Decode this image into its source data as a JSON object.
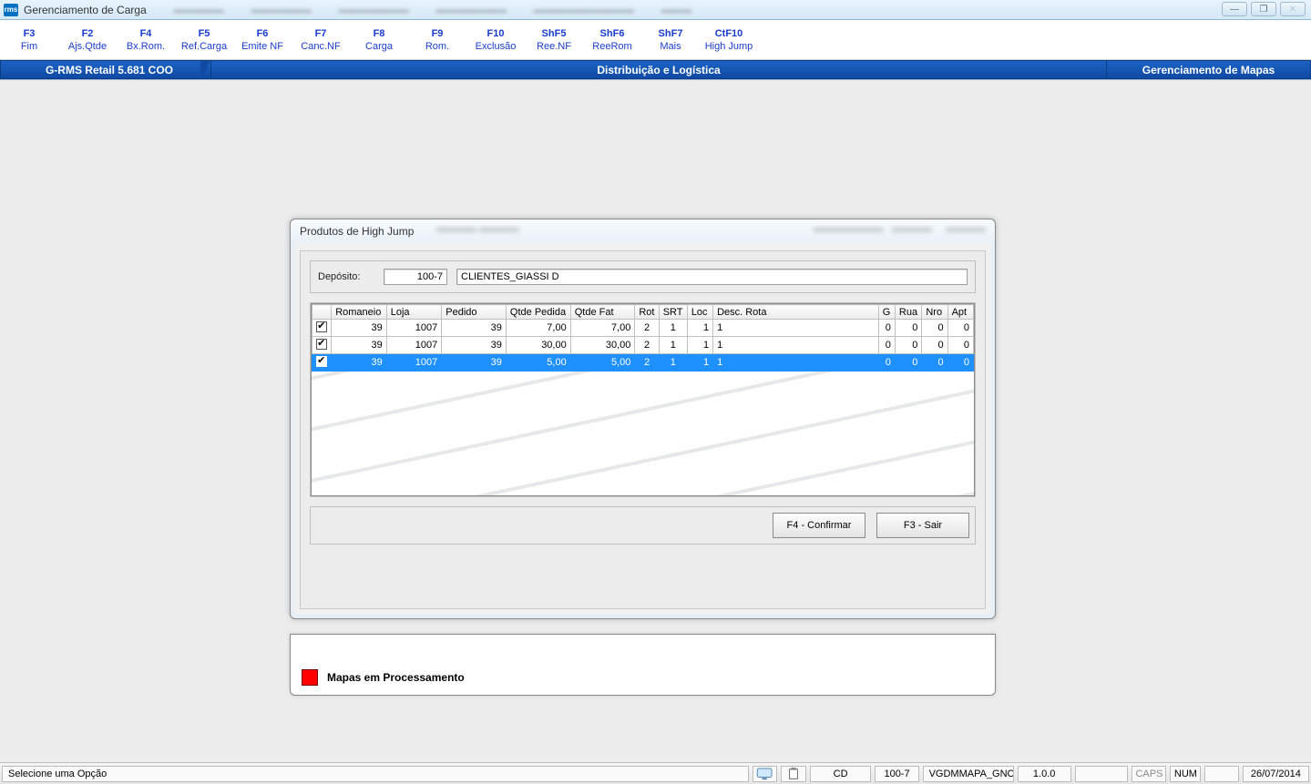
{
  "window": {
    "title": "Gerenciamento de Carga"
  },
  "fkeys": [
    {
      "key": "F3",
      "label": "Fim"
    },
    {
      "key": "F2",
      "label": "Ajs.Qtde"
    },
    {
      "key": "F4",
      "label": "Bx.Rom."
    },
    {
      "key": "F5",
      "label": "Ref.Carga"
    },
    {
      "key": "F6",
      "label": "Emite NF"
    },
    {
      "key": "F7",
      "label": "Canc.NF"
    },
    {
      "key": "F8",
      "label": "Carga"
    },
    {
      "key": "F9",
      "label": "Rom."
    },
    {
      "key": "F10",
      "label": "Exclusão"
    },
    {
      "key": "ShF5",
      "label": "Ree.NF"
    },
    {
      "key": "ShF6",
      "label": "ReeRom"
    },
    {
      "key": "ShF7",
      "label": "Mais"
    },
    {
      "key": "CtF10",
      "label": "High Jump"
    }
  ],
  "ribbon": {
    "left": "G-RMS Retail 5.681 COO",
    "center": "Distribuição e Logística",
    "right": "Gerenciamento de Mapas"
  },
  "dialog": {
    "title": "Produtos de High Jump",
    "deposito_label": "Depósito:",
    "deposito_code": "100-7",
    "deposito_name": "CLIENTES_GIASSI D",
    "columns": [
      "",
      "Romaneio",
      "Loja",
      "Pedido",
      "Qtde Pedida",
      "Qtde Fat",
      "Rot",
      "SRT",
      "Loc",
      "Desc. Rota",
      "G",
      "Rua",
      "Nro",
      "Apt"
    ],
    "rows": [
      {
        "sel": false,
        "chk": true,
        "romaneio": "39",
        "loja": "1007",
        "pedido": "39",
        "qp": "7,00",
        "qf": "7,00",
        "rot": "2",
        "srt": "1",
        "loc": "1",
        "desc": "1",
        "g": "0",
        "rua": "0",
        "nro": "0",
        "apt": "0"
      },
      {
        "sel": false,
        "chk": true,
        "romaneio": "39",
        "loja": "1007",
        "pedido": "39",
        "qp": "30,00",
        "qf": "30,00",
        "rot": "2",
        "srt": "1",
        "loc": "1",
        "desc": "1",
        "g": "0",
        "rua": "0",
        "nro": "0",
        "apt": "0"
      },
      {
        "sel": true,
        "chk": true,
        "romaneio": "39",
        "loja": "1007",
        "pedido": "39",
        "qp": "5,00",
        "qf": "5,00",
        "rot": "2",
        "srt": "1",
        "loc": "1",
        "desc": "1",
        "g": "0",
        "rua": "0",
        "nro": "0",
        "apt": "0"
      }
    ],
    "btn_confirm": "F4 - Confirmar",
    "btn_exit": "F3 - Sair"
  },
  "processing_label": "Mapas em Processamento",
  "status": {
    "hint": "Selecione uma Opção",
    "cd": "CD",
    "dep": "100-7",
    "prog": "VGDMMAPA_GNC",
    "ver": "1.0.0",
    "caps": "CAPS",
    "num": "NUM",
    "date": "26/07/2014"
  }
}
